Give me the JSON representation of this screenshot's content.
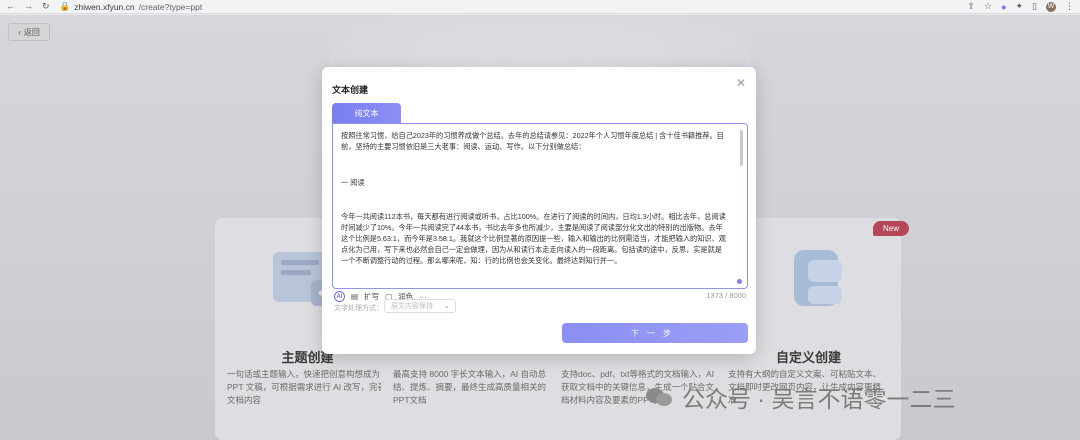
{
  "browser": {
    "url_domain": "zhiwen.xfyun.cn",
    "url_path": "/create?type=ppt",
    "avatar_letter": "W"
  },
  "back_button": {
    "label": "返回"
  },
  "cards": [
    {
      "title": "主题创建",
      "desc": "一句话或主题输入，快速把创意构想成为 PPT 文稿，可根据需求进行 AI 改写，完善文档内容"
    },
    {
      "title": "",
      "desc": "最高支持 8000 字长文本输入，AI 自动总结、提炼、摘要，最终生成高质量相关的PPT文档"
    },
    {
      "title": "",
      "desc": "支持doc、pdf、txt等格式的文档输入，AI获取文档中的关键信息，生成一个贴合文档材料内容及要素的PPT文档"
    },
    {
      "title": "自定义创建",
      "desc": "支持有大纲的自定义文案、可粘贴文本、文档即时更改网页内容，让生成内容更精准"
    }
  ],
  "new_badge": "New",
  "modal": {
    "title": "文本创建",
    "tab_label": "纯文本",
    "paragraphs": [
      "按照往常习惯，给自己2023年的习惯养成做个总结。去年的总结请参见：2022年个人习惯年度总结 | 含十佳书籍推荐。目前，坚持的主要习惯依旧是三大老事：阅读、运动、写作。以下分别做总结：",
      "一 阅读",
      "今年一共阅读112本书，每天都有进行阅读或听书，占比100%。在进行了阅读的时间内，日均1.3小时。相比去年，总阅读时间减少了10%。今年一共阅读完了44本书，书比去年多也所减少，主要是阅读了阅读部分化文出的特别的出版物。去年这个比例是5.63:1，而今年是3.58:1。我就这个比例显著的原因提一些，输入和输出的比例需适当，才能把输入的知识、观点化为己用，写下来也必然会自己一定会做理，因为从和读行本走走向读入的一段距离。包括读的途中，反思，实是就是一个不断调整行动的过程。那么哪来呢，知：行的比例也会关变化。最终达到知行并一。"
    ],
    "toolbar": {
      "ai": "AI",
      "expand": "扩写",
      "polish": "润色",
      "more": "···"
    },
    "counter": "1373 / 8000",
    "select_label": "文字处理方式：",
    "select_value": "原文内容保持",
    "next_button": "下一步"
  },
  "watermark": {
    "text": "公众号 · 吴言不语零一二三"
  }
}
